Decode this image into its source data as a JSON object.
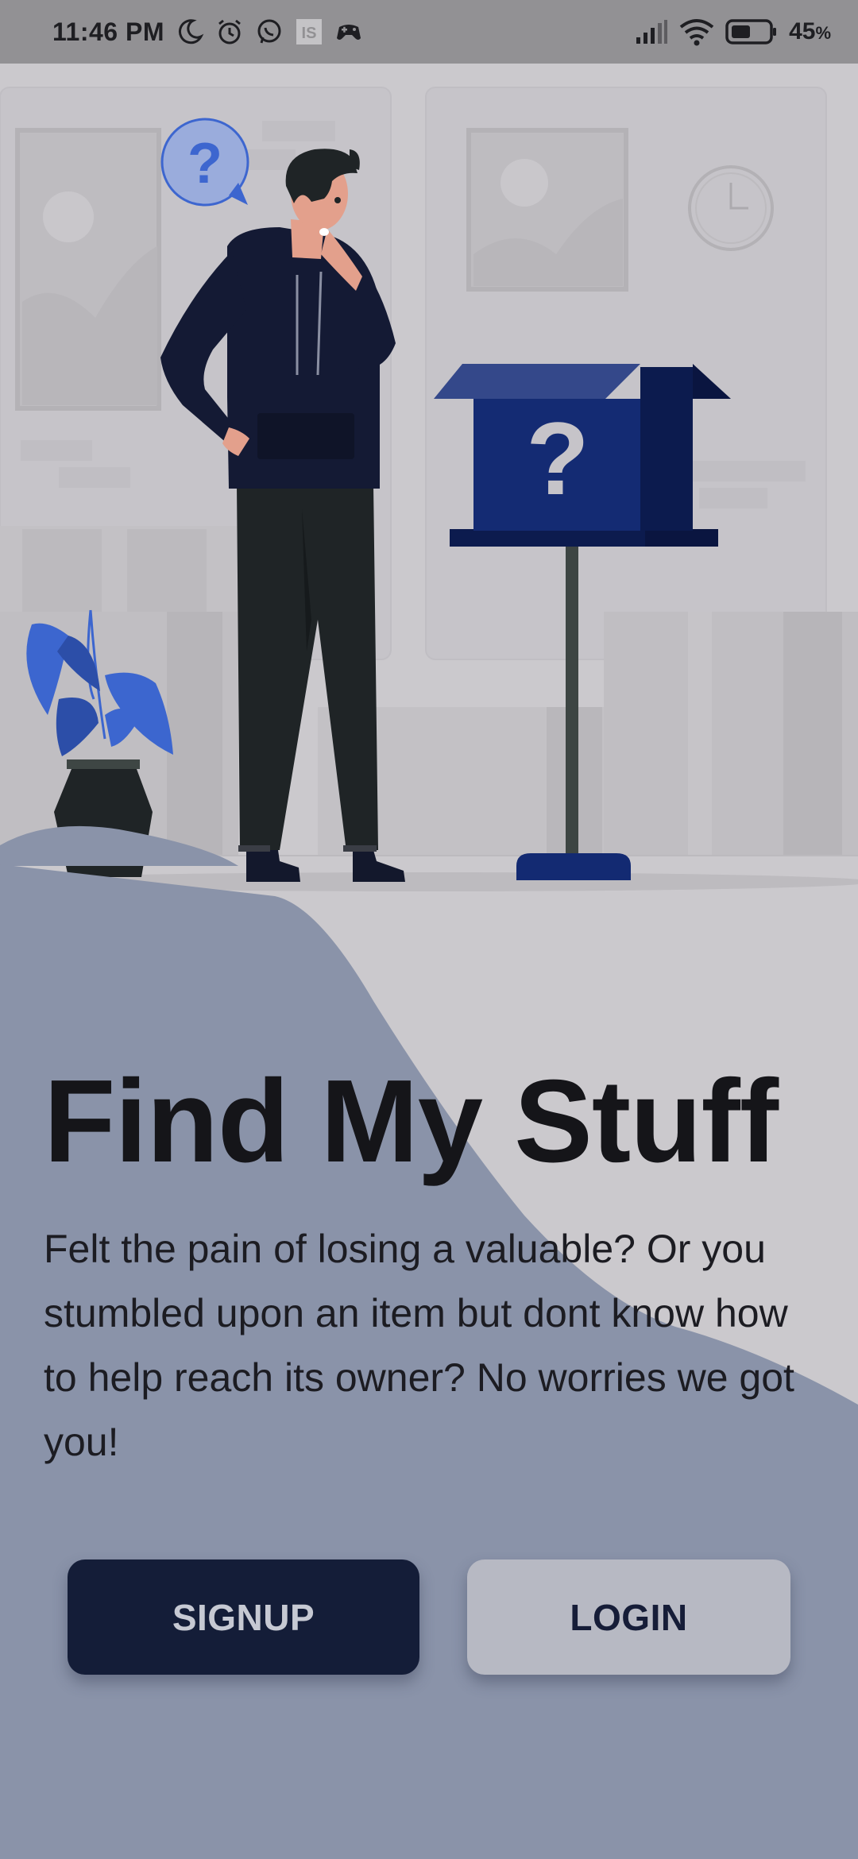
{
  "status_bar": {
    "time": "11:46 PM",
    "battery": "45",
    "battery_unit": "%",
    "icons_left": [
      "moon-icon",
      "alarm-icon",
      "whatsapp-icon",
      "is-app-icon",
      "game-controller-icon"
    ],
    "icons_right": [
      "signal-icon",
      "wifi-icon",
      "battery-icon"
    ]
  },
  "illustration": {
    "bubble_mark": "?",
    "mailbox_mark": "?"
  },
  "main": {
    "title": "Find My Stuff",
    "description": "Felt the pain of losing a valuable? Or you stumbled upon an item but dont know how to help reach its owner? No worries we got you!"
  },
  "buttons": {
    "signup": "SIGNUP",
    "login": "LOGIN"
  },
  "colors": {
    "background": "#cbc9cd",
    "wave": "#8a93a9",
    "signup_bg": "#141d38",
    "login_bg": "#b7b9c3",
    "mailbox": "#132a72",
    "plant": "#3c66cf"
  }
}
